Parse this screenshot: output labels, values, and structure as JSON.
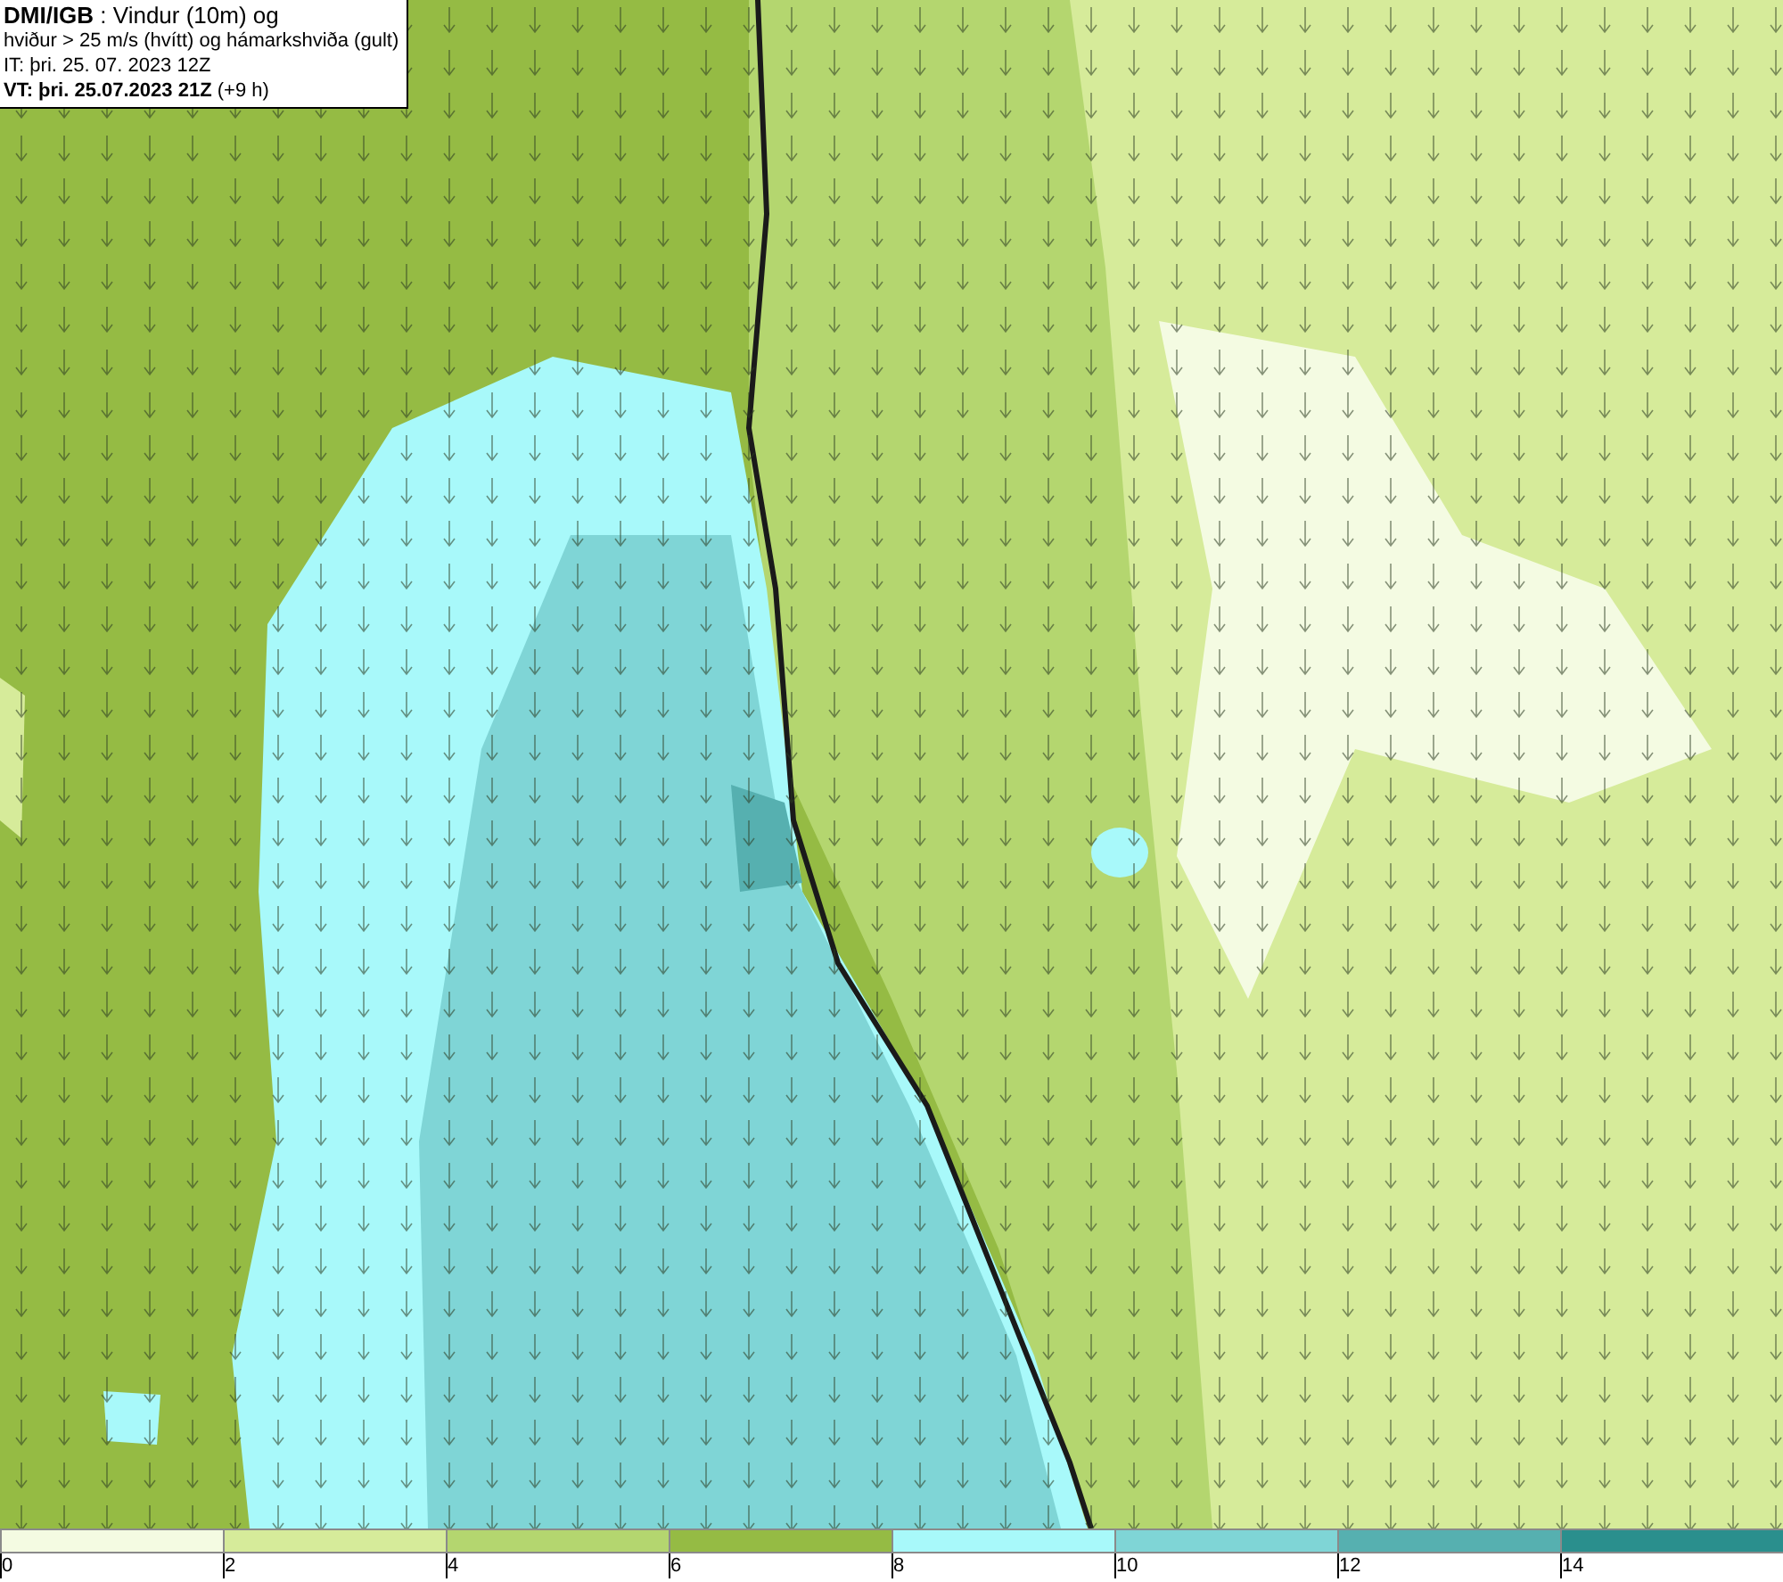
{
  "info_box": {
    "lines": [
      "**DMI/IGB** : Vindur (10m) og",
      "hviður > 25 m/s (hvítt) og hámarkshviða (gult)",
      "IT: þri. 25. 07. 2023 12Z",
      "**VT: þri. 25.07.2023 21Z** (+9 h)"
    ]
  },
  "color_scale": [
    {
      "label": "0",
      "color": "#f4fbe2"
    },
    {
      "label": "2",
      "color": "#d6eb9a"
    },
    {
      "label": "4",
      "color": "#b4d66f"
    },
    {
      "label": "6",
      "color": "#95bb44"
    },
    {
      "label": "8",
      "color": "#a8f9fa"
    },
    {
      "label": "10",
      "color": "#7fd5d6"
    },
    {
      "label": "12",
      "color": "#56b0b0"
    },
    {
      "label": "14",
      "color": "#2a8f8d"
    }
  ]
}
